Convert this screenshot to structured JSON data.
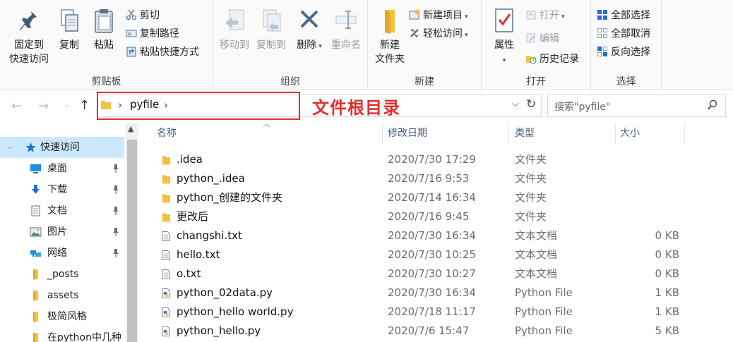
{
  "ribbon": {
    "clipboard": {
      "label": "剪贴板",
      "pin_quick_access": [
        "固定到",
        "快速访问"
      ],
      "copy": "复制",
      "paste": "粘贴",
      "cut": "剪切",
      "copy_path": "复制路径",
      "paste_shortcut": "粘贴快捷方式"
    },
    "organize": {
      "label": "组织",
      "move_to": "移动到",
      "copy_to": "复制到",
      "delete": "删除",
      "rename": "重命名"
    },
    "new": {
      "label": "新建",
      "new_folder": [
        "新建",
        "文件夹"
      ],
      "new_item": "新建项目",
      "easy_access": "轻松访问"
    },
    "open": {
      "label": "打开",
      "properties": "属性",
      "open": "打开",
      "edit": "编辑",
      "history": "历史记录"
    },
    "select": {
      "label": "选择",
      "select_all": "全部选择",
      "select_none": "全部取消",
      "invert": "反向选择"
    }
  },
  "address": {
    "crumb": "pyfile",
    "annotation": "文件根目录"
  },
  "search": {
    "placeholder": "搜索\"pyfile\""
  },
  "nav": {
    "quick_access": "快速访问",
    "items": [
      {
        "label": "桌面",
        "icon": "desktop-icon",
        "pinned": true
      },
      {
        "label": "下载",
        "icon": "download-icon",
        "pinned": true
      },
      {
        "label": "文档",
        "icon": "document-icon",
        "pinned": true
      },
      {
        "label": "图片",
        "icon": "picture-icon",
        "pinned": true
      },
      {
        "label": "网络",
        "icon": "network-icon",
        "pinned": true
      },
      {
        "label": "_posts",
        "icon": "folder-icon",
        "pinned": false
      },
      {
        "label": "assets",
        "icon": "folder-icon",
        "pinned": false
      },
      {
        "label": "极简风格",
        "icon": "folder-icon",
        "pinned": false
      },
      {
        "label": "在python中几种",
        "icon": "folder-icon",
        "pinned": false
      }
    ]
  },
  "columns": {
    "name": "名称",
    "modified": "修改日期",
    "type": "类型",
    "size": "大小"
  },
  "files": [
    {
      "name": ".idea",
      "modified": "2020/7/30 17:29",
      "type": "文件夹",
      "size": "",
      "icon": "folder"
    },
    {
      "name": "python_.idea",
      "modified": "2020/7/16 9:53",
      "type": "文件夹",
      "size": "",
      "icon": "folder"
    },
    {
      "name": "python_创建的文件夹",
      "modified": "2020/7/14 16:34",
      "type": "文件夹",
      "size": "",
      "icon": "folder"
    },
    {
      "name": "更改后",
      "modified": "2020/7/16 9:45",
      "type": "文件夹",
      "size": "",
      "icon": "folder"
    },
    {
      "name": "changshi.txt",
      "modified": "2020/7/30 16:34",
      "type": "文本文档",
      "size": "0 KB",
      "icon": "text"
    },
    {
      "name": "hello.txt",
      "modified": "2020/7/30 10:25",
      "type": "文本文档",
      "size": "0 KB",
      "icon": "text"
    },
    {
      "name": "o.txt",
      "modified": "2020/7/30 10:27",
      "type": "文本文档",
      "size": "0 KB",
      "icon": "text"
    },
    {
      "name": "python_02data.py",
      "modified": "2020/7/30 16:34",
      "type": "Python File",
      "size": "1 KB",
      "icon": "python"
    },
    {
      "name": "python_hello world.py",
      "modified": "2020/7/18 11:17",
      "type": "Python File",
      "size": "1 KB",
      "icon": "python"
    },
    {
      "name": "python_hello.py",
      "modified": "2020/7/6 15:47",
      "type": "Python File",
      "size": "5 KB",
      "icon": "python"
    }
  ],
  "colors": {
    "accent": "#1e6fd6",
    "folder": "#f5c242",
    "highlight": "#e0302a",
    "selection": "#cce8ff"
  }
}
